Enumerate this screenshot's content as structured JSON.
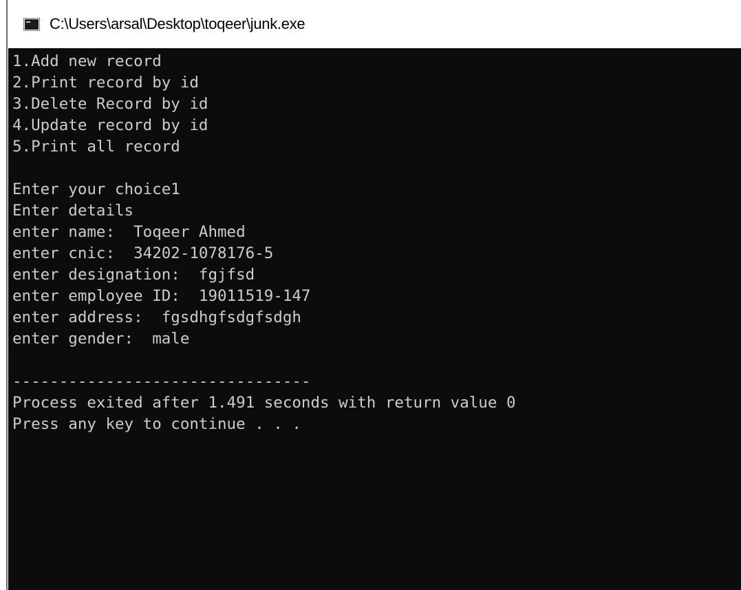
{
  "window": {
    "title": "C:\\Users\\arsal\\Desktop\\toqeer\\junk.exe",
    "icon": "console-app-icon"
  },
  "console": {
    "lines": [
      "1.Add new record",
      "2.Print record by id",
      "3.Delete Record by id",
      "4.Update record by id",
      "5.Print all record",
      "",
      "Enter your choice1",
      "Enter details",
      "enter name:  Toqeer Ahmed",
      "enter cnic:  34202-1078176-5",
      "enter designation:  fgjfsd",
      "enter employee ID:  19011519-147",
      "enter address:  fgsdhgfsdgfsdgh",
      "enter gender:  male",
      "",
      "--------------------------------",
      "Process exited after 1.491 seconds with return value 0",
      "Press any key to continue . . ."
    ]
  },
  "colors": {
    "console_background": "#0c0c0c",
    "console_text": "#cccccc",
    "titlebar_background": "#ffffff"
  }
}
